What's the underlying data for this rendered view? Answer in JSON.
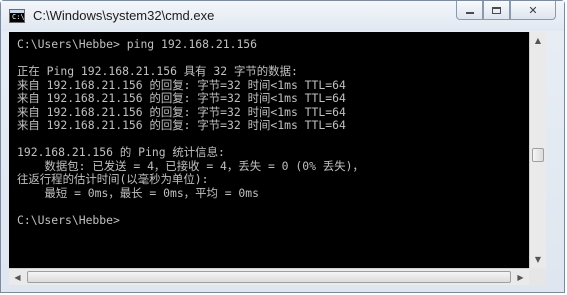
{
  "window": {
    "title": "C:\\Windows\\system32\\cmd.exe",
    "icon": "console-icon",
    "icon_glyph": "C:\\",
    "controls": {
      "minimize": "minimize-icon",
      "maximize": "maximize-icon",
      "close": "close-icon",
      "close_glyph": "✕"
    }
  },
  "console": {
    "lines": [
      "C:\\Users\\Hebbe> ping 192.168.21.156",
      "",
      "正在 Ping 192.168.21.156 具有 32 字节的数据:",
      "来自 192.168.21.156 的回复: 字节=32 时间<1ms TTL=64",
      "来自 192.168.21.156 的回复: 字节=32 时间<1ms TTL=64",
      "来自 192.168.21.156 的回复: 字节=32 时间<1ms TTL=64",
      "来自 192.168.21.156 的回复: 字节=32 时间<1ms TTL=64",
      "",
      "192.168.21.156 的 Ping 统计信息:",
      "    数据包: 已发送 = 4，已接收 = 4，丢失 = 0 (0% 丢失)，",
      "往返行程的估计时间(以毫秒为单位):",
      "    最短 = 0ms，最长 = 0ms，平均 = 0ms",
      "",
      "C:\\Users\\Hebbe>"
    ],
    "colors": {
      "background": "#000000",
      "text": "#c0c0c0"
    }
  },
  "scrollbars": {
    "vertical": {
      "up_glyph": "▲",
      "down_glyph": "▼"
    },
    "horizontal": {
      "left_glyph": "◀",
      "right_glyph": "▶"
    }
  }
}
